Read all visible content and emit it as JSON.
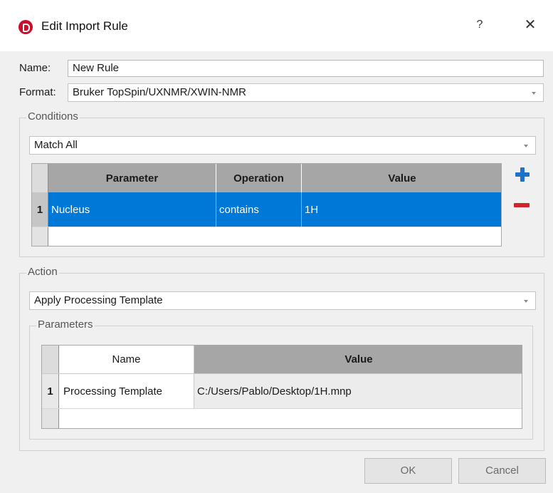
{
  "window": {
    "title": "Edit Import Rule",
    "help_label": "?",
    "close_label": "✕"
  },
  "form": {
    "name_label": "Name:",
    "name_value": "New Rule",
    "format_label": "Format:",
    "format_value": "Bruker TopSpin/UXNMR/XWIN-NMR"
  },
  "conditions": {
    "legend": "Conditions",
    "match_value": "Match All",
    "columns": [
      "Parameter",
      "Operation",
      "Value"
    ],
    "rows": [
      {
        "num": "1",
        "parameter": "Nucleus",
        "operation": "contains",
        "value": "1H"
      }
    ],
    "add_icon": "plus-icon",
    "remove_icon": "minus-icon"
  },
  "action": {
    "legend": "Action",
    "action_value": "Apply Processing Template",
    "parameters": {
      "legend": "Parameters",
      "columns": [
        "Name",
        "Value"
      ],
      "rows": [
        {
          "num": "1",
          "name": "Processing Template",
          "value": "C:/Users/Pablo/Desktop/1H.mnp"
        }
      ]
    }
  },
  "buttons": {
    "ok": "OK",
    "cancel": "Cancel"
  },
  "colors": {
    "selection": "#0078d7",
    "plus": "#1e73c8",
    "minus": "#d2232a",
    "header": "#a6a6a6"
  }
}
